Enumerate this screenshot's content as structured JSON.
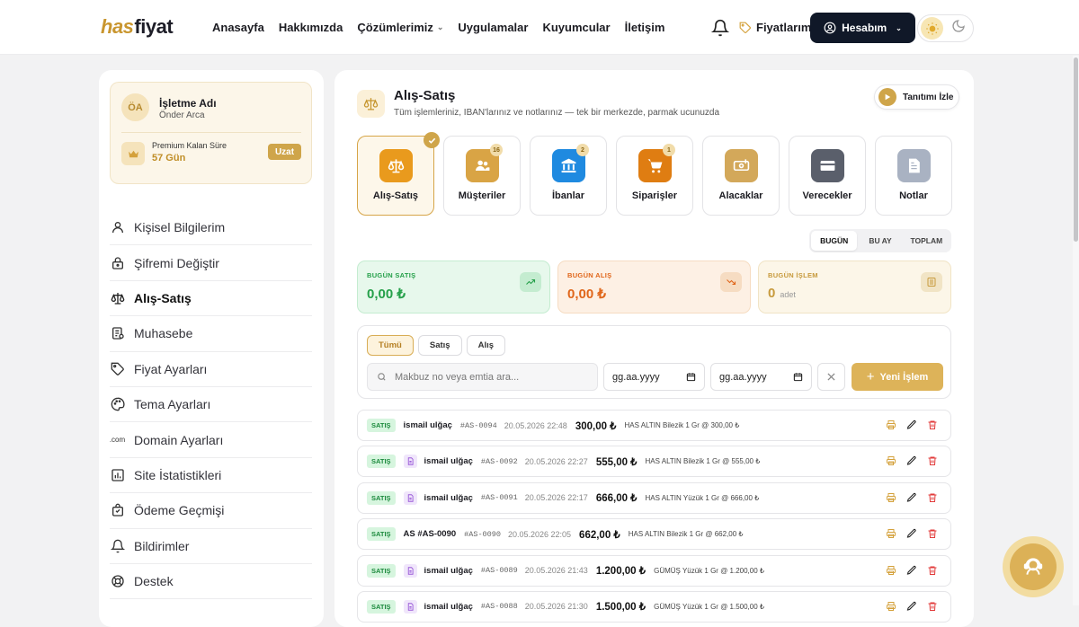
{
  "brand": {
    "logo_prefix": "has",
    "logo_suffix": "fiyat"
  },
  "nav": [
    {
      "label": "Anasayfa"
    },
    {
      "label": "Hakkımızda"
    },
    {
      "label": "Çözümlerimiz",
      "dropdown": true
    },
    {
      "label": "Uygulamalar"
    },
    {
      "label": "Kuyumcular"
    },
    {
      "label": "İletişim"
    }
  ],
  "header": {
    "favorites_label": "Fiyatlarım",
    "account_label": "Hesabım"
  },
  "business": {
    "initials": "ÖA",
    "name": "İşletme Adı",
    "owner": "Önder Arca",
    "premium_label": "Premium Kalan Süre",
    "premium_days": "57 Gün",
    "extend_label": "Uzat"
  },
  "menu": [
    {
      "label": "Kişisel Bilgilerim",
      "icon": "user-icon"
    },
    {
      "label": "Şifremi Değiştir",
      "icon": "lock-icon"
    },
    {
      "label": "Alış-Satış",
      "icon": "scale-icon",
      "active": true
    },
    {
      "label": "Muhasebe",
      "icon": "ledger-icon"
    },
    {
      "label": "Fiyat Ayarları",
      "icon": "tag-icon"
    },
    {
      "label": "Tema Ayarları",
      "icon": "palette-icon"
    },
    {
      "label": "Domain Ayarları",
      "icon": "dotcom-icon",
      "icon_text": ".com"
    },
    {
      "label": "Site İstatistikleri",
      "icon": "chart-icon"
    },
    {
      "label": "Ödeme Geçmişi",
      "icon": "bag-icon"
    },
    {
      "label": "Bildirimler",
      "icon": "bell-icon"
    },
    {
      "label": "Destek",
      "icon": "lifebuoy-icon"
    }
  ],
  "page": {
    "title": "Alış-Satış",
    "subtitle": "Tüm işlemleriniz, IBAN'larınız ve notlarınız — tek bir merkezde, parmak ucunuzda",
    "tour_label": "Tanıtımı İzle"
  },
  "tiles": [
    {
      "label": "Alış-Satış",
      "icon": "scale-icon",
      "color": "#e99a1d",
      "active": true
    },
    {
      "label": "Müşteriler",
      "icon": "users-icon",
      "color": "#d9a445",
      "badge": "16"
    },
    {
      "label": "İbanlar",
      "icon": "bank-icon",
      "color": "#1f8ae0",
      "badge": "2"
    },
    {
      "label": "Siparişler",
      "icon": "cart-icon",
      "color": "#df7d12",
      "badge": "1"
    },
    {
      "label": "Alacaklar",
      "icon": "money-icon",
      "color": "#d3a85a"
    },
    {
      "label": "Verecekler",
      "icon": "card-icon",
      "color": "#5a5f6b"
    },
    {
      "label": "Notlar",
      "icon": "note-icon",
      "color": "#a9b2c2"
    }
  ],
  "periods": [
    {
      "label": "BUGÜN",
      "active": true
    },
    {
      "label": "BU AY"
    },
    {
      "label": "TOPLAM"
    }
  ],
  "stats": [
    {
      "label": "BUGÜN SATIŞ",
      "value": "0,00 ₺",
      "unit": "",
      "color": "#25a04a",
      "bg": "#e7f8ec",
      "border": "#c4ecd0",
      "icon": "trend-up-icon"
    },
    {
      "label": "BUGÜN ALIŞ",
      "value": "0,00 ₺",
      "unit": "",
      "color": "#e0661a",
      "bg": "#fdf0e4",
      "border": "#f6dcc2",
      "icon": "trend-down-icon"
    },
    {
      "label": "BUGÜN İŞLEM",
      "value": "0",
      "unit": "adet",
      "color": "#c79a3c",
      "bg": "#fcf6e8",
      "border": "#f1e4c5",
      "icon": "receipt-icon"
    }
  ],
  "filters": {
    "chips": [
      {
        "label": "Tümü",
        "active": true
      },
      {
        "label": "Satış"
      },
      {
        "label": "Alış"
      }
    ],
    "search_placeholder": "Makbuz no veya emtia ara...",
    "date_placeholder": "gg.aa.yyyy",
    "new_label": "Yeni İşlem"
  },
  "transactions": [
    {
      "type": "SATIŞ",
      "doc": false,
      "customer": "ismail ulğaç",
      "no": "#AS-0094",
      "date": "20.05.2026 22:48",
      "amount": "300,00 ₺",
      "desc": "HAS ALTIN Bilezik 1 Gr @ 300,00 ₺"
    },
    {
      "type": "SATIŞ",
      "doc": true,
      "customer": "ismail ulğaç",
      "no": "#AS-0092",
      "date": "20.05.2026 22:27",
      "amount": "555,00 ₺",
      "desc": "HAS ALTIN Bilezik 1 Gr @ 555,00 ₺"
    },
    {
      "type": "SATIŞ",
      "doc": true,
      "customer": "ismail ulğaç",
      "no": "#AS-0091",
      "date": "20.05.2026 22:17",
      "amount": "666,00 ₺",
      "desc": "HAS ALTIN Yüzük 1 Gr @ 666,00 ₺"
    },
    {
      "type": "SATIŞ",
      "doc": false,
      "customer": "AS #AS-0090",
      "no": "#AS-0090",
      "date": "20.05.2026 22:05",
      "amount": "662,00 ₺",
      "desc": "HAS ALTIN Bilezik 1 Gr @ 662,00 ₺"
    },
    {
      "type": "SATIŞ",
      "doc": true,
      "customer": "ismail ulğaç",
      "no": "#AS-0089",
      "date": "20.05.2026 21:43",
      "amount": "1.200,00 ₺",
      "desc": "GÜMÜŞ Yüzük 1 Gr @ 1.200,00 ₺"
    },
    {
      "type": "SATIŞ",
      "doc": true,
      "customer": "ismail ulğaç",
      "no": "#AS-0088",
      "date": "20.05.2026 21:30",
      "amount": "1.500,00 ₺",
      "desc": "GÜMÜŞ Yüzük 1 Gr @ 1.500,00 ₺"
    }
  ]
}
